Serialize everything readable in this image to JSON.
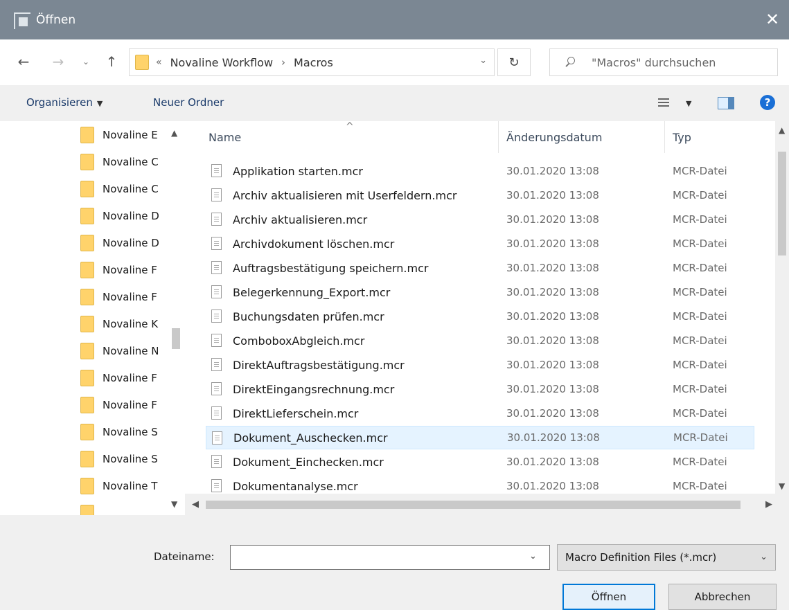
{
  "window": {
    "title": "Öffnen",
    "close_glyph": "✕"
  },
  "nav": {
    "back_icon": "arrow-left-icon",
    "forward_icon": "arrow-right-icon",
    "up_icon": "arrow-up-icon",
    "overflow": "«",
    "breadcrumbs": [
      "Novaline Workflow",
      "Macros"
    ],
    "search_placeholder": "\"Macros\" durchsuchen"
  },
  "toolbar": {
    "organize_label": "Organisieren",
    "new_folder_label": "Neuer Ordner",
    "help_label": "?"
  },
  "navpane": {
    "items": [
      "Novaline E",
      "Novaline C",
      "Novaline C",
      "Novaline D",
      "Novaline D",
      "Novaline F",
      "Novaline F",
      "Novaline K",
      "Novaline N",
      "Novaline F",
      "Novaline F",
      "Novaline S",
      "Novaline S",
      "Novaline T"
    ]
  },
  "filelist": {
    "columns": {
      "name": "Name",
      "date": "Änderungsdatum",
      "type": "Typ"
    },
    "selected_index": 11,
    "rows": [
      {
        "name": "Applikation starten.mcr",
        "date": "30.01.2020 13:08",
        "type": "MCR-Datei"
      },
      {
        "name": "Archiv aktualisieren mit Userfeldern.mcr",
        "date": "30.01.2020 13:08",
        "type": "MCR-Datei"
      },
      {
        "name": "Archiv aktualisieren.mcr",
        "date": "30.01.2020 13:08",
        "type": "MCR-Datei"
      },
      {
        "name": "Archivdokument löschen.mcr",
        "date": "30.01.2020 13:08",
        "type": "MCR-Datei"
      },
      {
        "name": "Auftragsbestätigung speichern.mcr",
        "date": "30.01.2020 13:08",
        "type": "MCR-Datei"
      },
      {
        "name": "Belegerkennung_Export.mcr",
        "date": "30.01.2020 13:08",
        "type": "MCR-Datei"
      },
      {
        "name": "Buchungsdaten prüfen.mcr",
        "date": "30.01.2020 13:08",
        "type": "MCR-Datei"
      },
      {
        "name": "ComboboxAbgleich.mcr",
        "date": "30.01.2020 13:08",
        "type": "MCR-Datei"
      },
      {
        "name": "DirektAuftragsbestätigung.mcr",
        "date": "30.01.2020 13:08",
        "type": "MCR-Datei"
      },
      {
        "name": "DirektEingangsrechnung.mcr",
        "date": "30.01.2020 13:08",
        "type": "MCR-Datei"
      },
      {
        "name": "DirektLieferschein.mcr",
        "date": "30.01.2020 13:08",
        "type": "MCR-Datei"
      },
      {
        "name": "Dokument_Auschecken.mcr",
        "date": "30.01.2020 13:08",
        "type": "MCR-Datei"
      },
      {
        "name": "Dokument_Einchecken.mcr",
        "date": "30.01.2020 13:08",
        "type": "MCR-Datei"
      },
      {
        "name": "Dokumentanalyse.mcr",
        "date": "30.01.2020 13:08",
        "type": "MCR-Datei"
      }
    ]
  },
  "bottom": {
    "filename_label": "Dateiname:",
    "filename_value": "",
    "filetype_value": "Macro Definition Files (*.mcr)",
    "open_label": "Öffnen",
    "cancel_label": "Abbrechen"
  },
  "colors": {
    "titlebar": "#7b8793",
    "selection": "#e5f3ff",
    "accent": "#0078d7",
    "folder": "#ffd36b"
  }
}
